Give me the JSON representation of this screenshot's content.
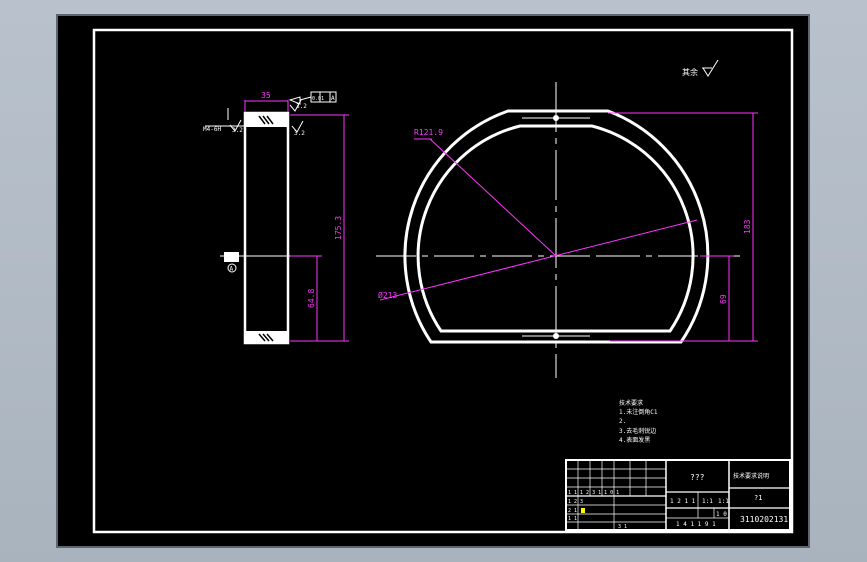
{
  "colors": {
    "background": "#000000",
    "outline": "#ffffff",
    "dimension": "#ff33ff",
    "titleblock_text": "#ffffff",
    "highlight": "#ffff00",
    "gray_frame": "#a9b3be"
  },
  "surface_mark": {
    "text": "其余"
  },
  "side_view": {
    "dim_width": "35",
    "dim_height": "175.3",
    "dim_lower": "64.8",
    "tolerance_flat": "0.01",
    "tol_ref_a": "A",
    "label_left": "M4-6H",
    "rough1": "3.2",
    "rough2": "3.2",
    "rough3": "3.2",
    "datum": "A"
  },
  "front_view": {
    "radius_label": "R121.9",
    "diameter_label": "Ø213",
    "dim_total_height": "183",
    "dim_lower_height": "69"
  },
  "notes": {
    "lines": [
      "技术要求",
      "1.未注倒角C1",
      "2.",
      "3.去毛刺锐边",
      "4.表面发黑"
    ]
  },
  "title_block": {
    "part_name": "???",
    "material_header": "技术要求说明",
    "scale_value": "?1",
    "drawing_number": "3110202131",
    "row_label_1": "1:1",
    "row_label_2": "1:1",
    "qty": "1:1",
    "sheet": "1 0",
    "small_1": "1 2 1 1",
    "small_2": "1 4 1 1 9 1",
    "small_3": "1 1 1 2 3 1 1 0 1",
    "small_4": "1 1 1 0",
    "left_1": "1 2 3",
    "left_2": "2 1",
    "left_3": "1 1",
    "left_4": "3 1"
  }
}
